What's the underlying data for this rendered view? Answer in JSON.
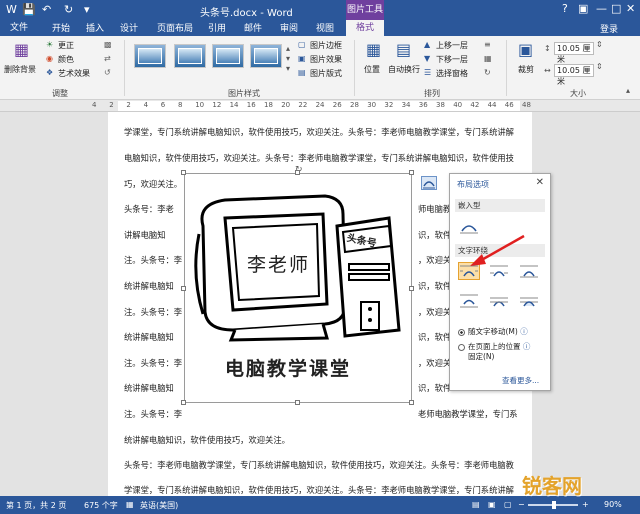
{
  "titlebar": {
    "doc_title": "头条号.docx - Word",
    "context_tab": "图片工具",
    "icons": [
      "save-icon",
      "undo-icon",
      "redo-icon",
      "customize-icon"
    ]
  },
  "tabs": [
    "文件",
    "开始",
    "插入",
    "设计",
    "页面布局",
    "引用",
    "邮件",
    "审阅",
    "视图",
    "格式"
  ],
  "login": "登录",
  "ribbon": {
    "remove_bg": "删除背景",
    "adjust": [
      "更正",
      "颜色",
      "艺术效果"
    ],
    "adjust_label": "调整",
    "styles_label": "图片样式",
    "style_opts": [
      "图片边框",
      "图片效果",
      "图片版式"
    ],
    "arrange": [
      "位置",
      "自动换行",
      "上移一层",
      "下移一层",
      "选择窗格"
    ],
    "arrange_label": "排列",
    "crop": "裁剪",
    "size_label": "大小",
    "height": "10.05 厘米",
    "width": "10.05 厘米"
  },
  "ruler_ticks": [
    "4",
    "2",
    "2",
    "4",
    "6",
    "8",
    "10",
    "12",
    "14",
    "16",
    "18",
    "20",
    "22",
    "24",
    "26",
    "28",
    "30",
    "32",
    "34",
    "36",
    "38",
    "40",
    "42",
    "44",
    "46",
    "48"
  ],
  "document": {
    "lines_full": [
      "学课堂，专门系统讲解电脑知识，软件使用技巧，欢迎关注。头条号：李老师电脑教学课堂，专门系统讲解",
      "电脑知识，软件使用技巧，欢迎关注。头条号：李老师电脑教学课堂，专门系统讲解电脑知识，软件使用技",
      "巧，欢迎关注。"
    ],
    "lines_left": [
      "头条号：李老",
      "讲解电脑知",
      "注。头条号：李",
      "统讲解电脑知",
      "注。头条号：李",
      "统讲解电脑知",
      "注。头条号：李",
      "统讲解电脑知",
      "注。头条号：李"
    ],
    "lines_right": [
      "师电脑教",
      "识，软件",
      "，欢迎关",
      "识，软件",
      "，欢迎关",
      "识，软件",
      "，欢迎关",
      "识，软件"
    ],
    "line_13_right": "老师电脑教学课堂，专门系",
    "lines_bottom": [
      "统讲解电脑知识，软件使用技巧，欢迎关注。",
      "头条号：李老师电脑教学课堂，专门系统讲解电脑知识，软件使用技巧，欢迎关注。头条号：李老师电脑教",
      "学课堂，专门系统讲解电脑知识，软件使用技巧，欢迎关注。头条号：李老师电脑教学课堂，专门系统讲解"
    ]
  },
  "picture": {
    "screen_text": "李老师",
    "tower_text": "头条号",
    "caption": "电脑教学课堂"
  },
  "layout_flyout": {
    "title": "布局选项",
    "inline_section": "嵌入型",
    "wrap_section": "文字环绕",
    "radio_move": "随文字移动(M)",
    "radio_fixed_1": "在页面上的位置",
    "radio_fixed_2": "固定(N)",
    "see_more": "查看更多..."
  },
  "statusbar": {
    "page": "第 1 页，共 2 页",
    "words": "675 个字",
    "lang": "英语(美国)",
    "zoom": "90%",
    "zoom_level": 0.9
  },
  "watermark": "锐客网",
  "colors": {
    "word_blue": "#2b579a",
    "picture_tools": "#6f3f9e",
    "selected_wrap": "#fcdfa8"
  }
}
